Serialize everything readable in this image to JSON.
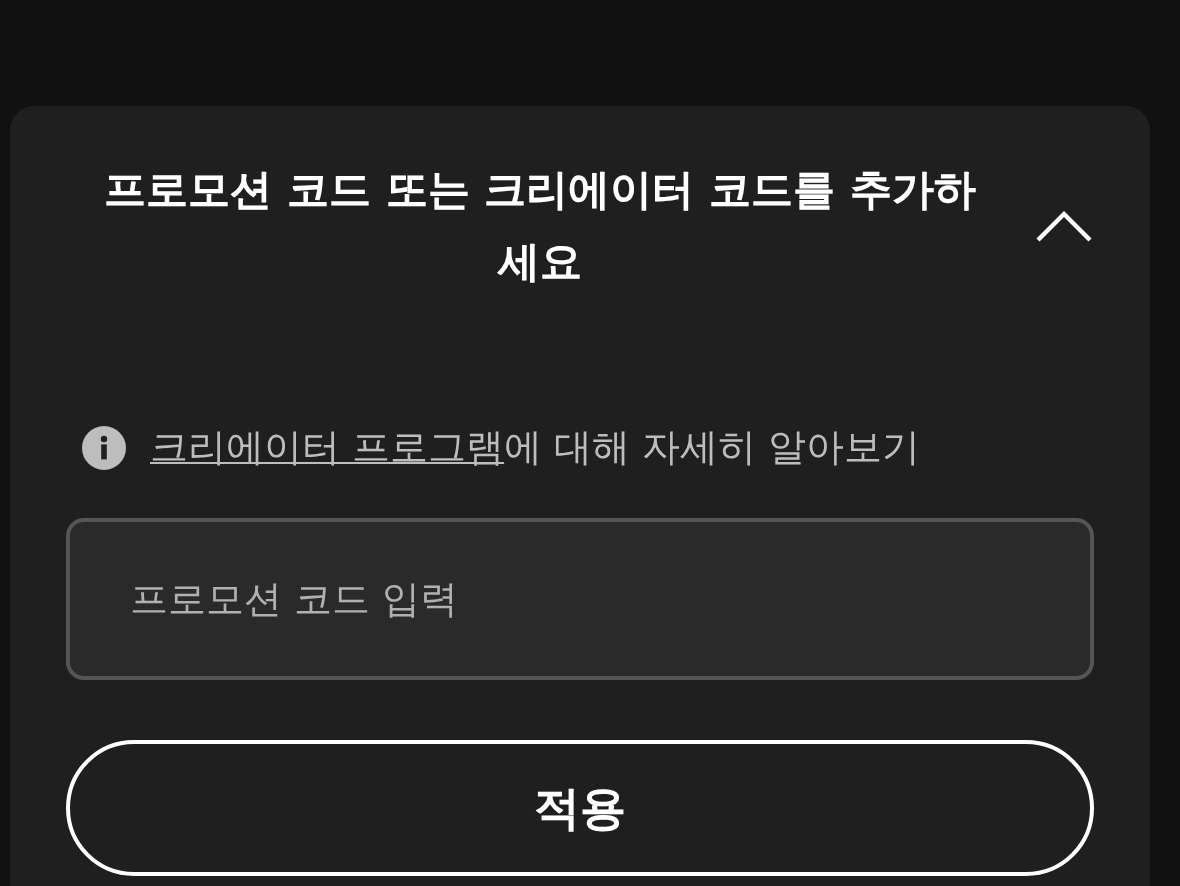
{
  "promo_panel": {
    "title": "프로모션 코드 또는 크리에이터 코드를 추가하세요",
    "expanded": true,
    "info": {
      "link": "크리에이터 프로그램",
      "text": "에 대해 자세히 알아보기"
    },
    "code_field": {
      "placeholder": "프로모션 코드 입력"
    },
    "apply_button": "적용"
  }
}
